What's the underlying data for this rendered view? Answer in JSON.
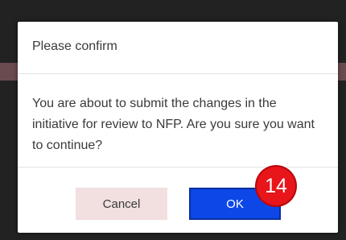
{
  "dialog": {
    "title": "Please confirm",
    "message": "You are about to submit the changes in the initiative for review to NFP. Are you sure you want to continue?",
    "cancel_label": "Cancel",
    "ok_label": "OK"
  },
  "annotation": {
    "step_number": "14"
  },
  "colors": {
    "ok_button": "#0d47e8",
    "cancel_button": "#f2dfe0",
    "step_badge": "#e8151b"
  }
}
